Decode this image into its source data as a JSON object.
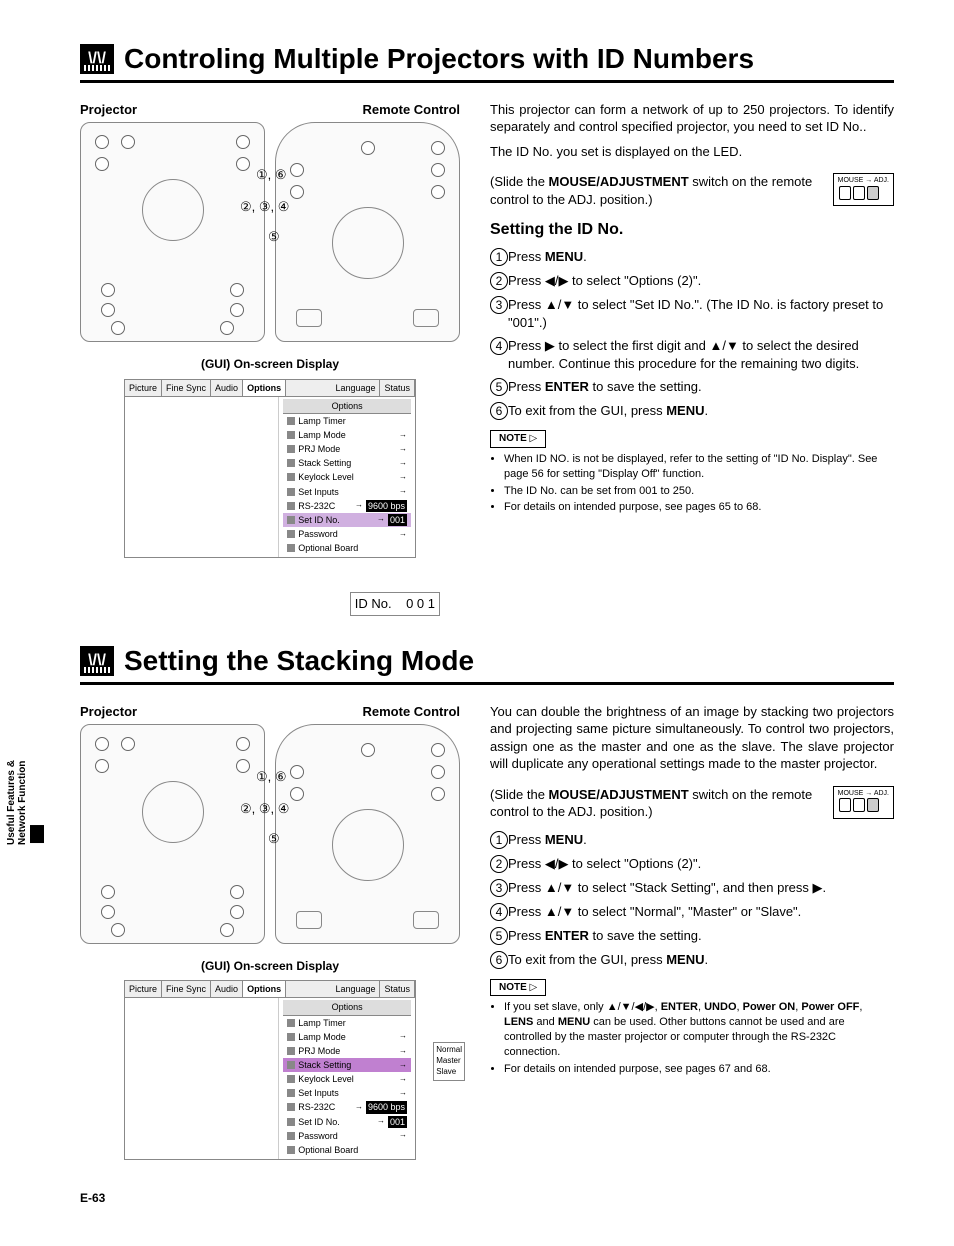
{
  "side_tab": {
    "line1": "Useful Features &",
    "line2": "Network Function"
  },
  "page_num": "E-63",
  "section1": {
    "title": "Controling Multiple Projectors with ID Numbers",
    "diag_projector": "Projector",
    "diag_remote": "Remote Control",
    "call1": "①, ⑥",
    "call2": "②, ③, ④",
    "call3": "⑤",
    "gui_title": "(GUI) On-screen Display",
    "gui": {
      "tabs": [
        "Picture",
        "Fine Sync",
        "Audio",
        "Options",
        "Language",
        "Status"
      ],
      "options_header": "Options",
      "items": [
        "Lamp Timer",
        "Lamp Mode",
        "PRJ Mode",
        "Stack Setting",
        "Keylock Level",
        "Set Inputs",
        "RS-232C",
        "Set ID No.",
        "Password",
        "Optional Board"
      ],
      "rs232c_val": "9600 bps",
      "setid_val": "001",
      "popup_label": "ID No.",
      "popup_val": "0 0 1"
    },
    "intro_p1": "This projector can form a network of up to 250 projectors. To identify separately and control specified projector, you need to set ID No..",
    "intro_p2": "The ID No. you set is displayed on the LED.",
    "mouse_adj": "(Slide the MOUSE/ADJUSTMENT switch on the remote control to the ADJ. position.)",
    "mouse_labels": {
      "l": "MOUSE",
      "r": "ADJ."
    },
    "subheading": "Setting the ID No.",
    "steps": [
      {
        "n": "1",
        "t_pre": "Press ",
        "t_bold": "MENU",
        "t_post": "."
      },
      {
        "n": "2",
        "t_pre": "Press ◀/▶ to select \"Options (2)\".",
        "t_bold": "",
        "t_post": ""
      },
      {
        "n": "3",
        "t_pre": "Press ▲/▼ to select \"Set ID No.\". (The ID No. is factory preset to \"001\".)",
        "t_bold": "",
        "t_post": ""
      },
      {
        "n": "4",
        "t_pre": "Press ▶ to select the first digit and ▲/▼ to select the desired number. Continue this procedure for the remaining two digits.",
        "t_bold": "",
        "t_post": ""
      },
      {
        "n": "5",
        "t_pre": "Press ",
        "t_bold": "ENTER",
        "t_post": " to save the setting."
      },
      {
        "n": "6",
        "t_pre": "To exit from the GUI, press ",
        "t_bold": "MENU",
        "t_post": "."
      }
    ],
    "note_label": "NOTE",
    "notes": [
      "When ID NO. is not be displayed, refer to the setting of \"ID No. Display\". See page 56 for setting \"Display Off\" function.",
      "The ID No. can be set from 001 to 250.",
      "For details on intended purpose, see pages 65 to 68."
    ]
  },
  "section2": {
    "title": "Setting the Stacking Mode",
    "diag_projector": "Projector",
    "diag_remote": "Remote Control",
    "call1": "①, ⑥",
    "call2": "②, ③, ④",
    "call3": "⑤",
    "gui_title": "(GUI) On-screen Display",
    "gui": {
      "tabs": [
        "Picture",
        "Fine Sync",
        "Audio",
        "Options",
        "Language",
        "Status"
      ],
      "options_header": "Options",
      "items": [
        "Lamp Timer",
        "Lamp Mode",
        "PRJ Mode",
        "Stack Setting",
        "Keylock Level",
        "Set Inputs",
        "RS-232C",
        "Set ID No.",
        "Password",
        "Optional Board"
      ],
      "rs232c_val": "9600 bps",
      "setid_val": "001",
      "sub_items": [
        "Normal",
        "Master",
        "Slave"
      ]
    },
    "intro_p1": "You can double the brightness of an image by stacking two projectors and projecting same picture simultaneously. To control two projectors, assign one as the master and one as the slave. The slave projector will duplicate any operational settings made to the master projector.",
    "mouse_adj": "(Slide the MOUSE/ADJUSTMENT switch on the remote control to the ADJ. position.)",
    "mouse_labels": {
      "l": "MOUSE",
      "r": "ADJ."
    },
    "steps": [
      {
        "n": "1",
        "t_pre": "Press ",
        "t_bold": "MENU",
        "t_post": "."
      },
      {
        "n": "2",
        "t_pre": "Press ◀/▶ to select \"Options (2)\".",
        "t_bold": "",
        "t_post": ""
      },
      {
        "n": "3",
        "t_pre": "Press ▲/▼ to select \"Stack Setting\", and then press ▶.",
        "t_bold": "",
        "t_post": ""
      },
      {
        "n": "4",
        "t_pre": "Press ▲/▼ to select \"Normal\", \"Master\" or \"Slave\".",
        "t_bold": "",
        "t_post": ""
      },
      {
        "n": "5",
        "t_pre": "Press ",
        "t_bold": "ENTER",
        "t_post": " to save the setting."
      },
      {
        "n": "6",
        "t_pre": "To exit from the GUI, press ",
        "t_bold": "MENU",
        "t_post": "."
      }
    ],
    "note_label": "NOTE",
    "notes": [
      "If you set slave, only ▲/▼/◀/▶, ENTER, UNDO, Power ON, Power OFF, LENS and MENU can be used. Other buttons cannot be used and are controlled by the master projector or computer through the RS-232C connection.",
      "For details on intended purpose, see pages 67 and 68."
    ]
  }
}
